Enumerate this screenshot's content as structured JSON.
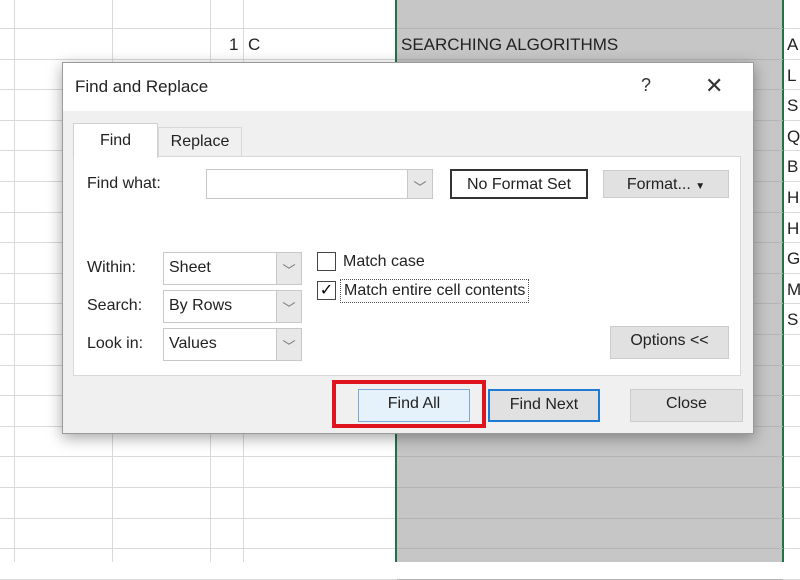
{
  "sheet": {
    "cells": [
      {
        "text": "1",
        "col": "num"
      },
      {
        "text": "C",
        "col": "c"
      },
      {
        "text": "SEARCHING ALGORITHMS",
        "col": "main"
      }
    ],
    "right_column": [
      "A",
      "L",
      "S",
      "Q",
      "B",
      "H",
      "H",
      "G",
      "M",
      "S"
    ],
    "selection_color": "#c6c6c6",
    "selection_border_color": "#217346"
  },
  "dialog": {
    "title": "Find and Replace",
    "help": "?",
    "close_icon": "close-icon",
    "tabs": [
      {
        "label": "Find",
        "active": true
      },
      {
        "label": "Replace",
        "active": false
      }
    ],
    "find_what_label": "Find what:",
    "find_what_value": "",
    "no_format_label": "No Format Set",
    "format_button": "Format...",
    "within_label": "Within:",
    "within_value": "Sheet",
    "search_label": "Search:",
    "search_value": "By Rows",
    "lookin_label": "Look in:",
    "lookin_value": "Values",
    "match_case_label": "Match case",
    "match_case_checked": false,
    "match_entire_label": "Match entire cell contents",
    "match_entire_checked": true,
    "options_button": "Options <<",
    "find_all_button": "Find All",
    "find_next_button": "Find Next",
    "close_button": "Close",
    "highlight_color": "#e0141e"
  }
}
